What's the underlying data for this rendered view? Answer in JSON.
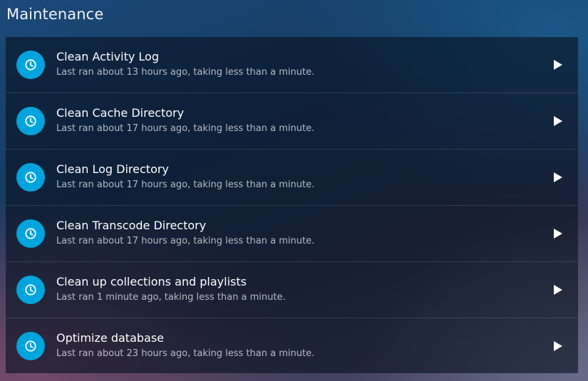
{
  "page": {
    "title": "Maintenance"
  },
  "colors": {
    "accent": "#00a4dc",
    "primary_text": "#ffffff",
    "secondary_text": "#b7bcc4"
  },
  "tasks": [
    {
      "name": "Clean Activity Log",
      "status": "Last ran about 13 hours ago, taking less than a minute.",
      "icon": "clock-icon",
      "action_icon": "play-icon"
    },
    {
      "name": "Clean Cache Directory",
      "status": "Last ran about 17 hours ago, taking less than a minute.",
      "icon": "clock-icon",
      "action_icon": "play-icon"
    },
    {
      "name": "Clean Log Directory",
      "status": "Last ran about 17 hours ago, taking less than a minute.",
      "icon": "clock-icon",
      "action_icon": "play-icon"
    },
    {
      "name": "Clean Transcode Directory",
      "status": "Last ran about 17 hours ago, taking less than a minute.",
      "icon": "clock-icon",
      "action_icon": "play-icon"
    },
    {
      "name": "Clean up collections and playlists",
      "status": "Last ran 1 minute ago, taking less than a minute.",
      "icon": "clock-icon",
      "action_icon": "play-icon"
    },
    {
      "name": "Optimize database",
      "status": "Last ran about 23 hours ago, taking less than a minute.",
      "icon": "clock-icon",
      "action_icon": "play-icon"
    }
  ]
}
